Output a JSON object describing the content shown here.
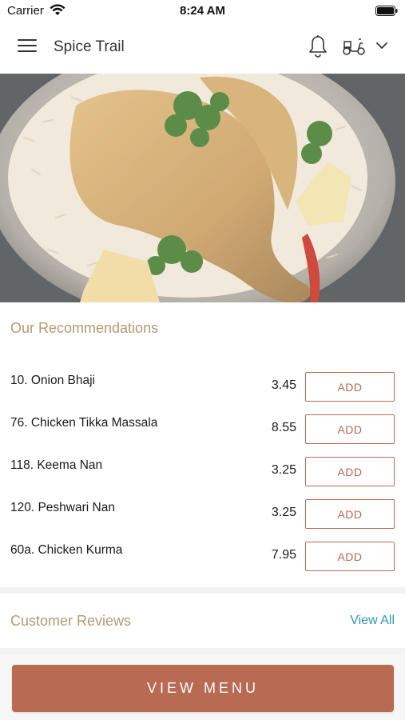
{
  "status_bar": {
    "carrier": "Carrier",
    "time": "8:24 AM"
  },
  "header": {
    "title": "Spice Trail",
    "icons": [
      "menu-icon",
      "bell-icon",
      "scooter-icon",
      "chevron-down-icon"
    ]
  },
  "hero": {
    "description_icon": "food-photo"
  },
  "recommendations": {
    "title": "Our Recommendations",
    "items": [
      {
        "name": "10. Onion Bhaji",
        "price": "3.45",
        "button": "ADD"
      },
      {
        "name": "76. Chicken Tikka Massala",
        "price": "8.55",
        "button": "ADD"
      },
      {
        "name": "118. Keema Nan",
        "price": "3.25",
        "button": "ADD"
      },
      {
        "name": "120. Peshwari Nan",
        "price": "3.25",
        "button": "ADD"
      },
      {
        "name": "60a. Chicken Kurma",
        "price": "7.95",
        "button": "ADD"
      }
    ]
  },
  "reviews": {
    "title": "Customer Reviews",
    "view_all": "View All"
  },
  "footer": {
    "view_menu": "VIEW MENU"
  },
  "colors": {
    "accent": "#b96a53",
    "section_title": "#b39a72",
    "link": "#2a98bf"
  }
}
